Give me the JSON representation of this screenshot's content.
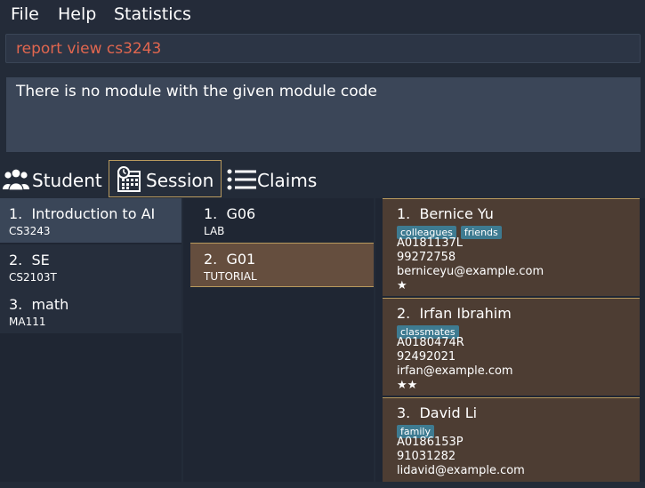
{
  "menu": {
    "file": "File",
    "help": "Help",
    "statistics": "Statistics"
  },
  "command": {
    "value": "report view cs3243",
    "color": "#e0664f"
  },
  "result": {
    "text": "There is no module with the given module code"
  },
  "tabs": [
    {
      "label": "Student",
      "icon": "students-icon"
    },
    {
      "label": "Session",
      "icon": "calendar-clock-icon"
    },
    {
      "label": "Claims",
      "icon": "list-icon"
    }
  ],
  "modules": [
    {
      "index": "1.",
      "name": "Introduction to AI",
      "code": "CS3243"
    },
    {
      "index": "2.",
      "name": "SE",
      "code": "CS2103T"
    },
    {
      "index": "3.",
      "name": "math",
      "code": "MA111"
    }
  ],
  "sessions": [
    {
      "index": "1.",
      "name": "G06",
      "type": "LAB"
    },
    {
      "index": "2.",
      "name": "G01",
      "type": "TUTORIAL"
    }
  ],
  "students": [
    {
      "index": "1.",
      "name": "Bernice Yu",
      "tags": [
        "colleagues",
        "friends"
      ],
      "id": "A0181137L",
      "phone": "99272758",
      "email": "berniceyu@example.com",
      "rating": "★"
    },
    {
      "index": "2.",
      "name": "Irfan Ibrahim",
      "tags": [
        "classmates"
      ],
      "id": "A0180474R",
      "phone": "92492021",
      "email": "irfan@example.com",
      "rating": "★★"
    },
    {
      "index": "3.",
      "name": "David Li",
      "tags": [
        "family"
      ],
      "id": "A0186153P",
      "phone": "91031282",
      "email": "lidavid@example.com",
      "rating": ""
    }
  ]
}
